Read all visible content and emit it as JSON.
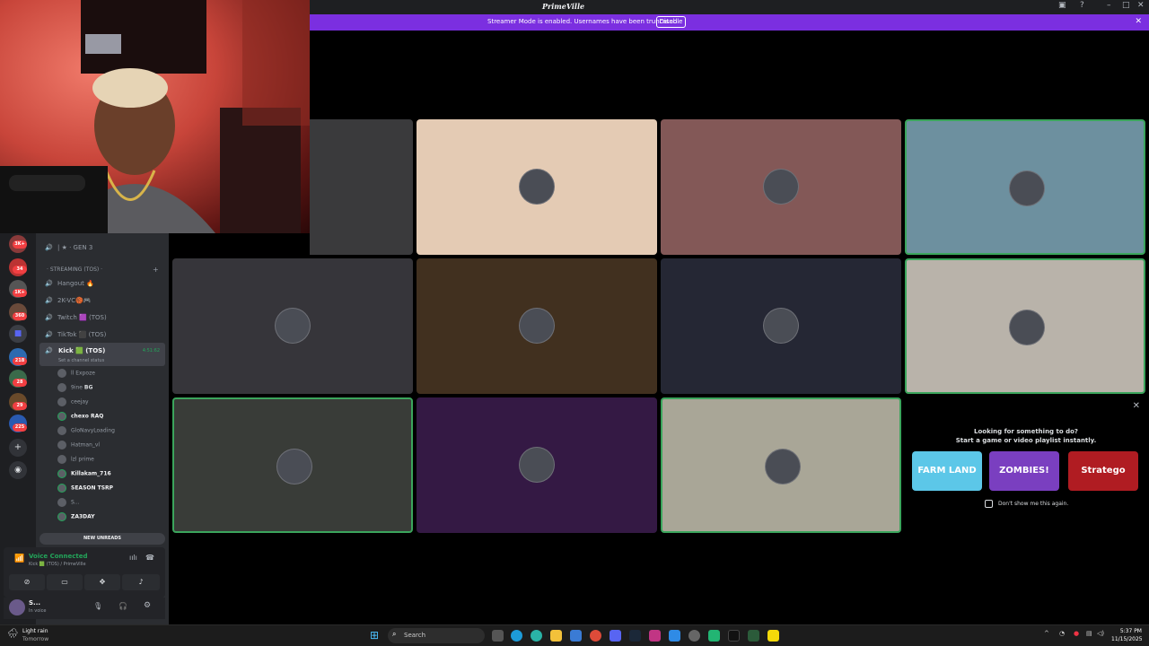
{
  "window": {
    "title": "PrimeVille",
    "controls": [
      "inbox-icon",
      "help-icon",
      "minimize-icon",
      "maximize-icon",
      "close-icon"
    ]
  },
  "banner": {
    "text": "Streamer Mode is enabled. Usernames have been truncated.",
    "disable_label": "Disable",
    "color": "#7b2fe0"
  },
  "rail": {
    "badges": [
      "3K+",
      "34",
      "1K+",
      "360",
      "218",
      "28",
      "29",
      "225"
    ]
  },
  "channels": {
    "top_channel": "| ★ · GEN 3",
    "category": "· STREAMING (TOS) ·",
    "items": [
      {
        "name": "Hangout 🔥"
      },
      {
        "name": "2K-VC🏀🎮"
      },
      {
        "name": "Twitch 🟪 (TOS)"
      },
      {
        "name": "TikTok ⬛ (TOS)"
      },
      {
        "name": "Kick 🟩 (TOS)",
        "timer": "4:51:62",
        "status": "Set a channel status"
      }
    ],
    "users": [
      {
        "name": "ll Expoze"
      },
      {
        "name": "9ine",
        "tag": "BG"
      },
      {
        "name": "ceejay"
      },
      {
        "name": "chexo",
        "tag": "RAQ"
      },
      {
        "name": "GloNavyLoading"
      },
      {
        "name": "Hatman_vl"
      },
      {
        "name": "lzl prime"
      },
      {
        "name": "Killakam_716"
      },
      {
        "name": "SEASON",
        "tag": "TSRP"
      },
      {
        "name": "S..."
      },
      {
        "name": "ZA3DAY"
      }
    ],
    "new_unreads": "NEW UNREADS"
  },
  "voice": {
    "status": "Voice Connected",
    "location": "Kick 🟩 (TOS) / PrimeVille",
    "color": "#23a55a"
  },
  "user_panel": {
    "name": "S...",
    "status": "In voice"
  },
  "tiles": [
    {
      "bg": "#3a3a3c",
      "speaking": false,
      "avatar": false
    },
    {
      "bg": "#e4cbb4",
      "speaking": false,
      "avatar": true
    },
    {
      "bg": "#835857",
      "speaking": false,
      "avatar": true
    },
    {
      "bg": "#6d909f",
      "speaking": true,
      "avatar": true
    },
    {
      "bg": "#36353a",
      "speaking": false,
      "avatar": true
    },
    {
      "bg": "#41301f",
      "speaking": false,
      "avatar": true
    },
    {
      "bg": "#252734",
      "speaking": false,
      "avatar": true
    },
    {
      "bg": "#b9b3aa",
      "speaking": true,
      "avatar": true
    },
    {
      "bg": "#393c38",
      "speaking": true,
      "avatar": true
    },
    {
      "bg": "#341944",
      "speaking": false,
      "avatar": true
    },
    {
      "bg": "#a9a697",
      "speaking": true,
      "avatar": true
    }
  ],
  "activity": {
    "heading": "Looking for something to do?",
    "subheading": "Start a game or video playlist instantly.",
    "games": [
      {
        "label": "FARM LAND",
        "color": "#5cc7e8"
      },
      {
        "label": "ZOMBIES!",
        "color": "#7a3fc0"
      },
      {
        "label": "Stratego",
        "color": "#b01c22"
      }
    ],
    "dont_show": "Don't show me this again."
  },
  "taskbar": {
    "weather": "Light rain",
    "weather_sub": "Tomorrow",
    "search_placeholder": "Search",
    "time": "5:37 PM",
    "date": "11/15/2025"
  }
}
